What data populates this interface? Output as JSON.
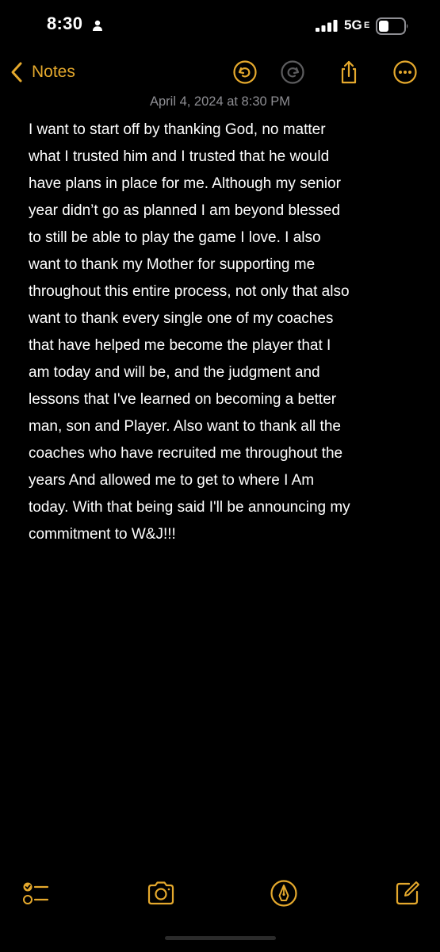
{
  "status_bar": {
    "time": "8:30",
    "network": "5G",
    "network_suffix": "E"
  },
  "nav": {
    "back_label": "Notes"
  },
  "note": {
    "date": "April 4, 2024 at 8:30 PM",
    "lines": [
      "I want to start off by thanking God, no matter",
      "what I trusted him and I trusted that he would",
      "have plans in place for me. Although my senior",
      "year didn’t go as planned I am beyond blessed",
      "to still be able to play the game I love. I also",
      "want to thank my Mother for supporting me",
      "throughout this entire process, not only that also",
      "want to thank every single one of my coaches",
      "that have helped me become the player that I",
      "am today and will be, and the judgment and",
      "lessons that I've learned on becoming a better",
      "man, son and Player. Also want to thank all the",
      "coaches who have recruited me throughout the",
      "years And allowed me to get to where I Am",
      "today. With that being said I'll be announcing my",
      "commitment to W&J!!!"
    ]
  },
  "icons": {
    "person": "person-icon",
    "signal": "signal-bars-icon",
    "battery": "battery-icon",
    "back": "chevron-left-icon",
    "undo": "undo-icon",
    "redo": "redo-icon",
    "share": "share-icon",
    "more": "more-ellipsis-icon",
    "checklist": "checklist-icon",
    "camera": "camera-icon",
    "markup": "markup-pen-icon",
    "compose": "compose-icon"
  },
  "colors": {
    "accent": "#E5A92D",
    "background": "#000000",
    "date_text": "#8E8E93",
    "disabled_icon": "#5C5C5E"
  }
}
